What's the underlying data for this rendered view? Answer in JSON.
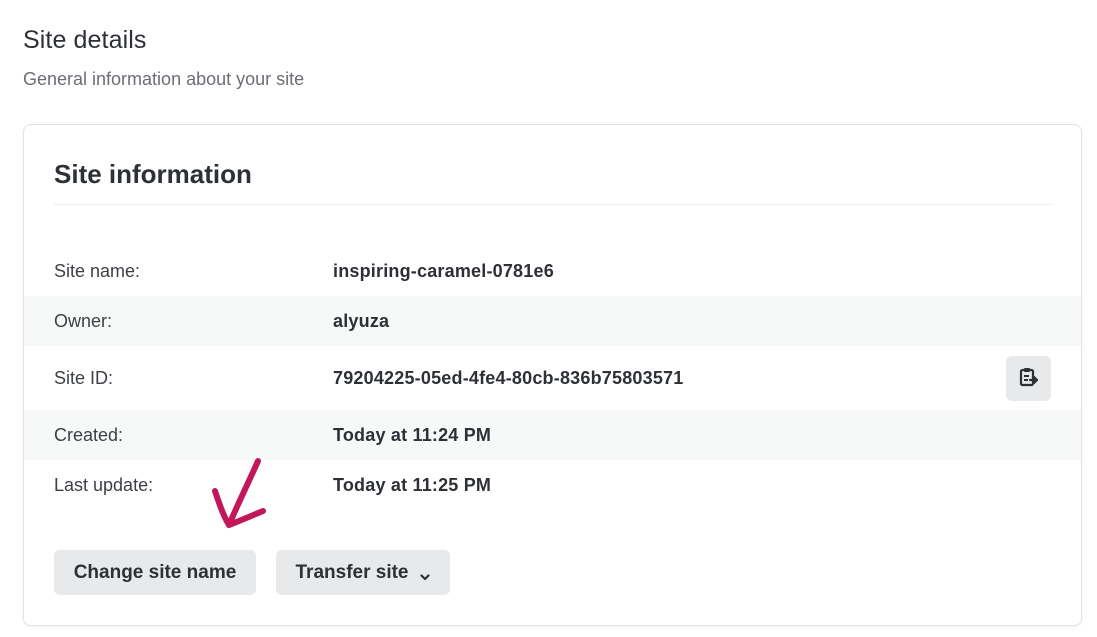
{
  "header": {
    "title": "Site details",
    "subtitle": "General information about your site"
  },
  "card": {
    "title": "Site information",
    "rows": [
      {
        "label": "Site name:",
        "value": "inspiring-caramel-0781e6"
      },
      {
        "label": "Owner:",
        "value": "alyuza"
      },
      {
        "label": "Site ID:",
        "value": "79204225-05ed-4fe4-80cb-836b75803571"
      },
      {
        "label": "Created:",
        "value": "Today at 11:24 PM"
      },
      {
        "label": "Last update:",
        "value": "Today at 11:25 PM"
      }
    ],
    "copy_icon": "clipboard-copy-icon",
    "actions": {
      "change_label": "Change site name",
      "transfer_label": "Transfer site",
      "transfer_icon": "chevron-down-icon"
    }
  },
  "annotation": {
    "arrow_icon": "hand-drawn-arrow-icon",
    "arrow_color": "#c2185b"
  },
  "colors": {
    "button_bg": "#e8e9eb",
    "alt_row_bg": "#f7f8f8",
    "text": "#2d3035"
  }
}
